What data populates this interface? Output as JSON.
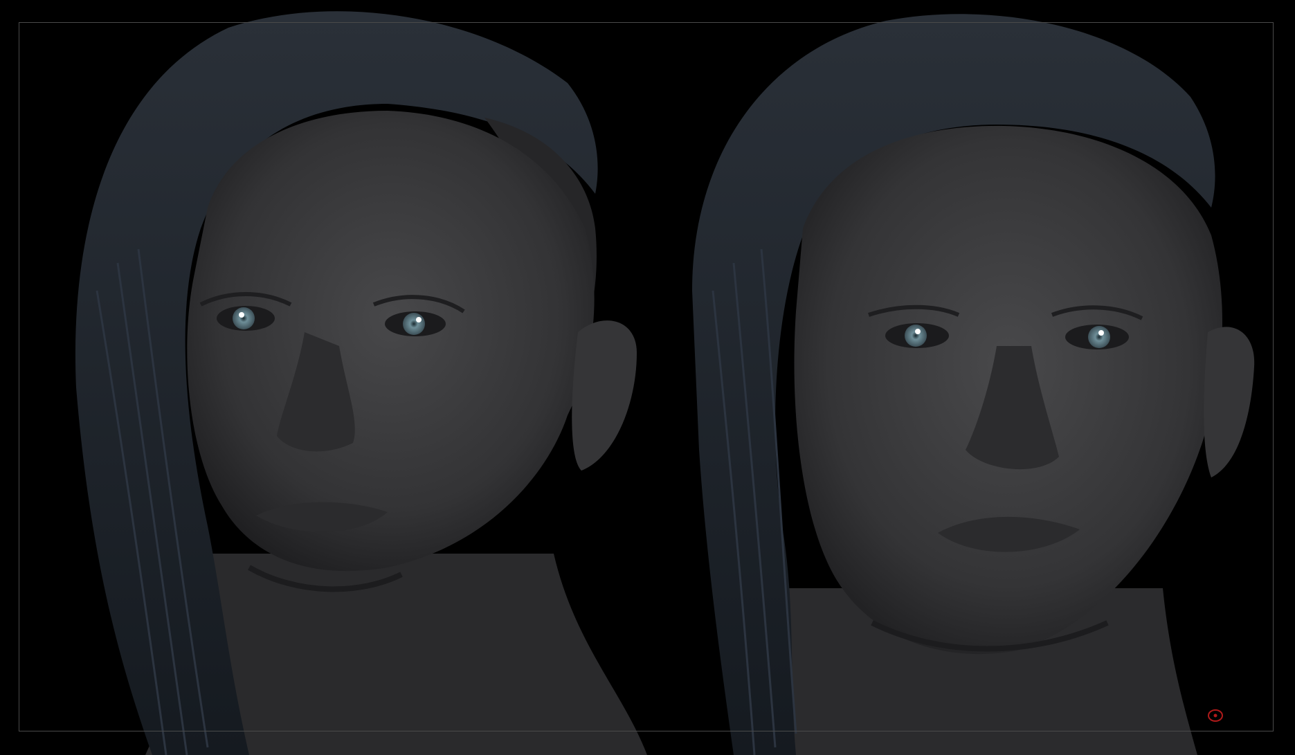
{
  "canvas": {
    "background_color": "#000000",
    "frame_border_color": "#4a4a4a"
  },
  "views": [
    {
      "name": "three-quarter-view",
      "skin_color": "#3a3a3c",
      "hair_color": "#1c222a",
      "iris_color": "#6e8e98"
    },
    {
      "name": "front-view",
      "skin_color": "#3a3a3c",
      "hair_color": "#1c222a",
      "iris_color": "#6e8e98"
    }
  ],
  "marker": {
    "icon": "red-circle-marker-icon",
    "color": "#b01a1a"
  }
}
